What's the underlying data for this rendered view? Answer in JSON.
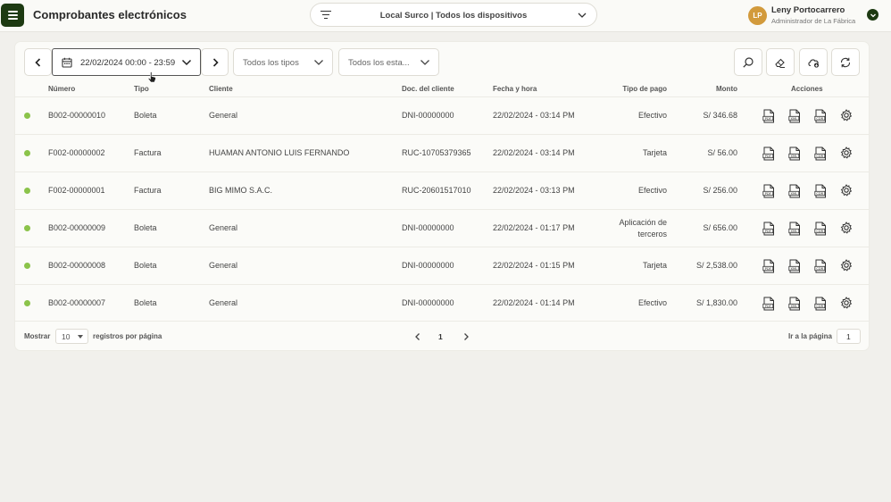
{
  "app": {
    "title": "Comprobantes electrónicos"
  },
  "filter": {
    "label": "Local Surco | Todos los dispositivos"
  },
  "user": {
    "initials": "LP",
    "name": "Leny Portocarrero",
    "role": "Administrador de La Fábrica"
  },
  "toolbar": {
    "date_range": "22/02/2024 00:00 - 23:59",
    "type_select": "Todos los tipos",
    "status_select": "Todos los esta..."
  },
  "table": {
    "headers": [
      "Número",
      "Tipo",
      "Cliente",
      "Doc. del cliente",
      "Fecha y hora",
      "Tipo de pago",
      "Monto",
      "Acciones"
    ],
    "rows": [
      {
        "numero": "B002-00000010",
        "tipo": "Boleta",
        "cliente": "General",
        "doc": "DNI-00000000",
        "fecha": "22/02/2024 - 03:14 PM",
        "pago": "Efectivo",
        "monto": "S/ 346.68"
      },
      {
        "numero": "F002-00000002",
        "tipo": "Factura",
        "cliente": "HUAMAN ANTONIO LUIS FERNANDO",
        "doc": "RUC-10705379365",
        "fecha": "22/02/2024 - 03:14 PM",
        "pago": "Tarjeta",
        "monto": "S/ 56.00"
      },
      {
        "numero": "F002-00000001",
        "tipo": "Factura",
        "cliente": "BIG MIMO S.A.C.",
        "doc": "RUC-20601517010",
        "fecha": "22/02/2024 - 03:13 PM",
        "pago": "Efectivo",
        "monto": "S/ 256.00"
      },
      {
        "numero": "B002-00000009",
        "tipo": "Boleta",
        "cliente": "General",
        "doc": "DNI-00000000",
        "fecha": "22/02/2024 - 01:17 PM",
        "pago": "Aplicación de terceros",
        "monto": "S/ 656.00"
      },
      {
        "numero": "B002-00000008",
        "tipo": "Boleta",
        "cliente": "General",
        "doc": "DNI-00000000",
        "fecha": "22/02/2024 - 01:15 PM",
        "pago": "Tarjeta",
        "monto": "S/ 2,538.00"
      },
      {
        "numero": "B002-00000007",
        "tipo": "Boleta",
        "cliente": "General",
        "doc": "DNI-00000000",
        "fecha": "22/02/2024 - 01:14 PM",
        "pago": "Efectivo",
        "monto": "S/ 1,830.00"
      }
    ]
  },
  "footer": {
    "show_label": "Mostrar",
    "per_page": "10",
    "per_page_label": "registros por página",
    "current_page": "1",
    "goto_label": "Ir a la página",
    "goto_value": "1"
  },
  "colors": {
    "brand": "#1d3a12",
    "status_dot": "#8bc34a",
    "avatar": "#d29a3c"
  },
  "icons": [
    "menu-icon",
    "filter-icon",
    "chevron-down-icon",
    "chevron-left-icon",
    "chevron-right-icon",
    "calendar-icon",
    "search-icon",
    "eraser-icon",
    "cloud-icon",
    "refresh-icon",
    "pdf-icon",
    "xml-icon",
    "cdr-icon",
    "gear-icon"
  ]
}
